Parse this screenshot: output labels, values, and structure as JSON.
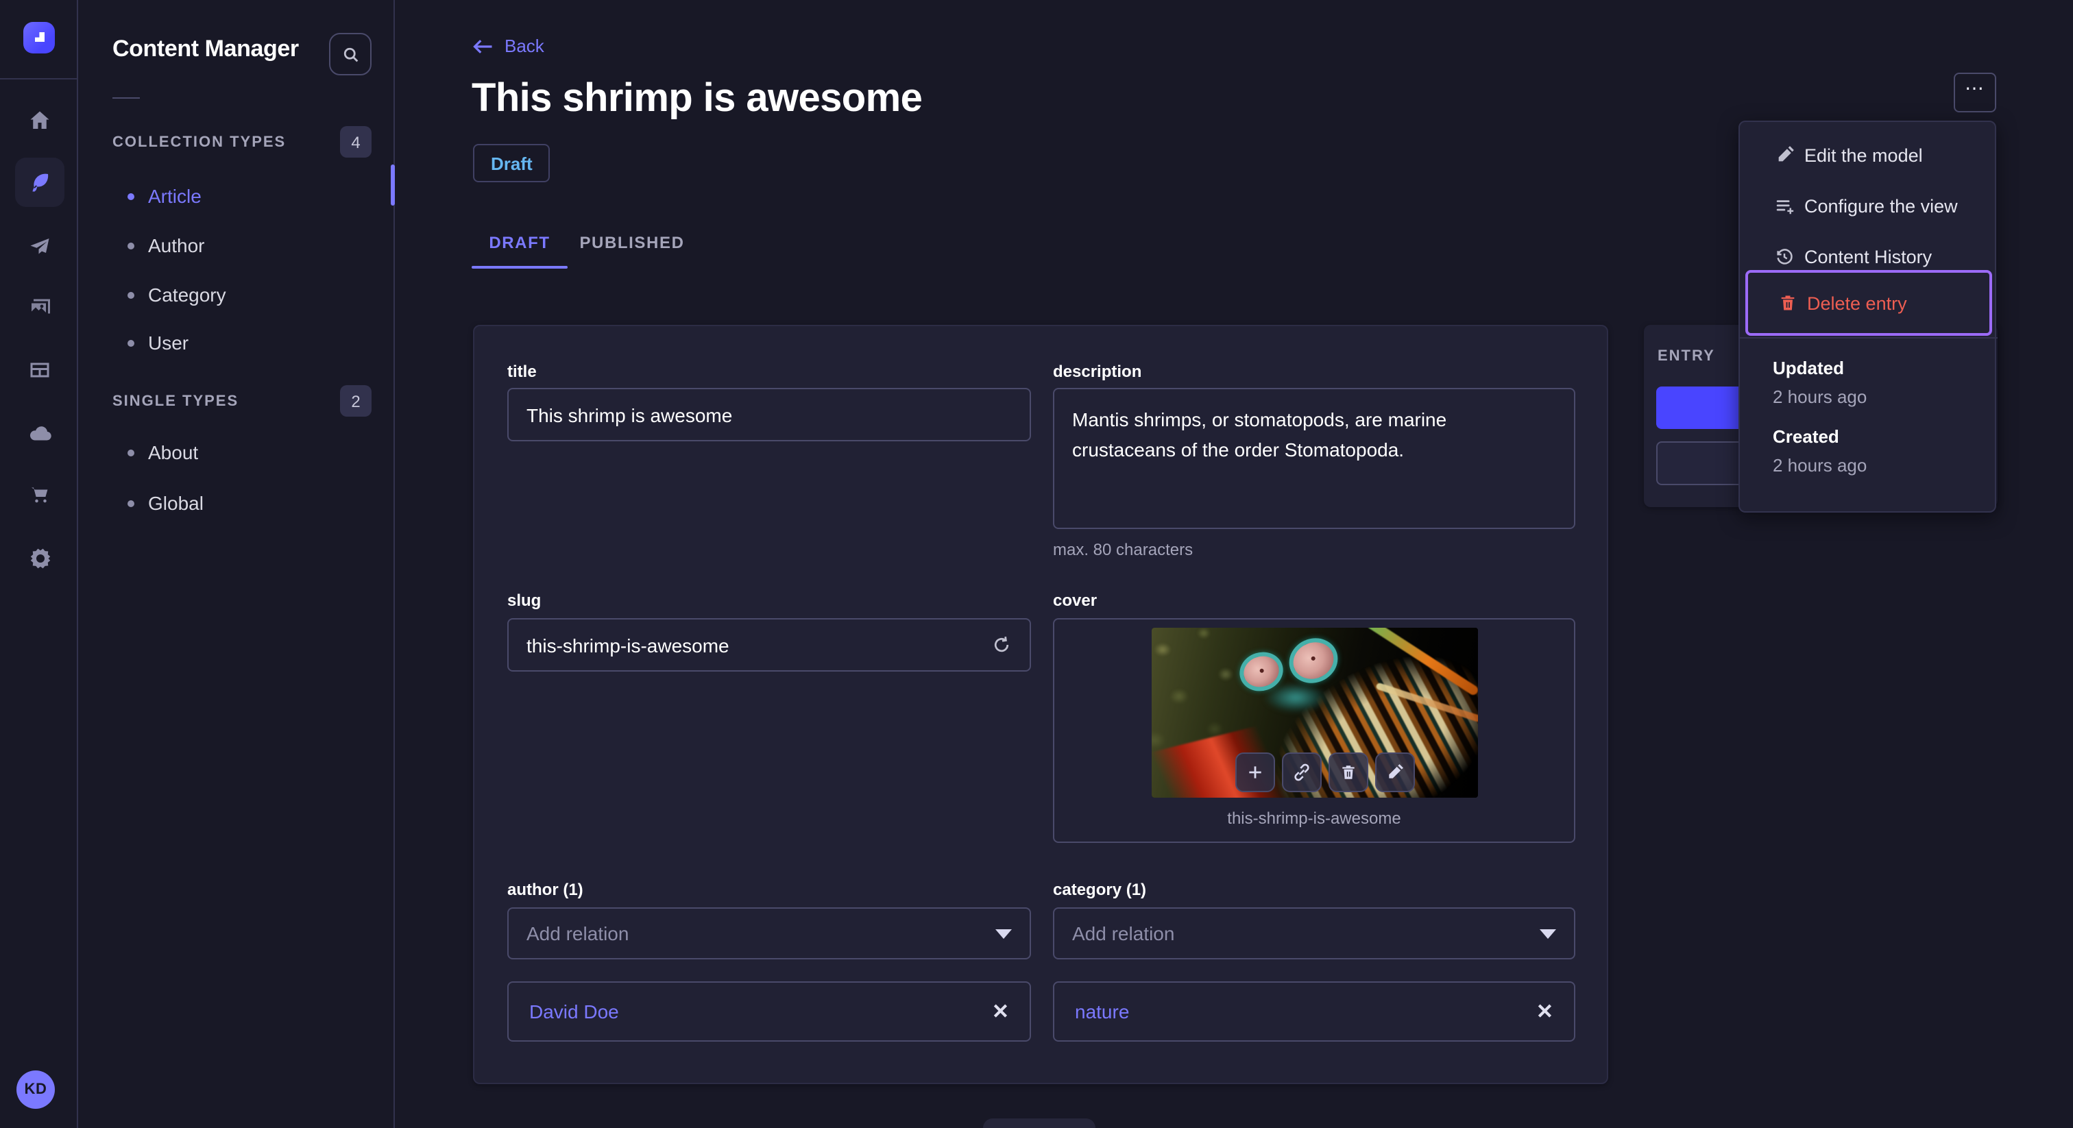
{
  "colors": {
    "bg": "#181826",
    "panel": "#212134",
    "border": "#32324d",
    "inputBorder": "#4a4a6a",
    "text": "#ffffff",
    "muted": "#a5a5ba",
    "accent": "#7b79ff",
    "primary": "#4945ff",
    "danger": "#ee5e52",
    "draft": "#66b7f1",
    "focus": "#9c6bf7"
  },
  "rail": {
    "avatar": "KD",
    "icons": [
      "strapi-logo",
      "home",
      "content",
      "releases",
      "media-library",
      "content-type-builder",
      "deploy",
      "marketplace",
      "settings"
    ]
  },
  "sidebar": {
    "title": "Content Manager",
    "collection": {
      "label": "COLLECTION TYPES",
      "count": "4",
      "items": [
        {
          "label": "Article"
        },
        {
          "label": "Author"
        },
        {
          "label": "Category"
        },
        {
          "label": "User"
        }
      ]
    },
    "single": {
      "label": "SINGLE TYPES",
      "count": "2",
      "items": [
        {
          "label": "About"
        },
        {
          "label": "Global"
        }
      ]
    }
  },
  "header": {
    "back": "Back",
    "title": "This shrimp is awesome",
    "status": "Draft"
  },
  "tabs": {
    "draft": "DRAFT",
    "published": "PUBLISHED"
  },
  "form": {
    "title": {
      "label": "title",
      "value": "This shrimp is awesome"
    },
    "description": {
      "label": "description",
      "value": "Mantis shrimps, or stomatopods, are marine crustaceans of the order Stomatopoda.",
      "helper": "max. 80 characters"
    },
    "slug": {
      "label": "slug",
      "value": "this-shrimp-is-awesome"
    },
    "cover": {
      "label": "cover",
      "caption": "this-shrimp-is-awesome"
    },
    "author": {
      "label": "author (1)",
      "placeholder": "Add relation",
      "relation": "David Doe",
      "remove": "✕"
    },
    "category": {
      "label": "category (1)",
      "placeholder": "Add relation",
      "relation": "nature",
      "remove": "✕"
    }
  },
  "entry": {
    "label": "ENTRY"
  },
  "more": {
    "label": "⋯"
  },
  "menu": {
    "items": [
      {
        "label": "Edit the model"
      },
      {
        "label": "Configure the view"
      },
      {
        "label": "Content History"
      },
      {
        "label": "Delete entry"
      }
    ],
    "meta": [
      {
        "label": "Updated",
        "value": "2 hours ago"
      },
      {
        "label": "Created",
        "value": "2 hours ago"
      }
    ]
  }
}
